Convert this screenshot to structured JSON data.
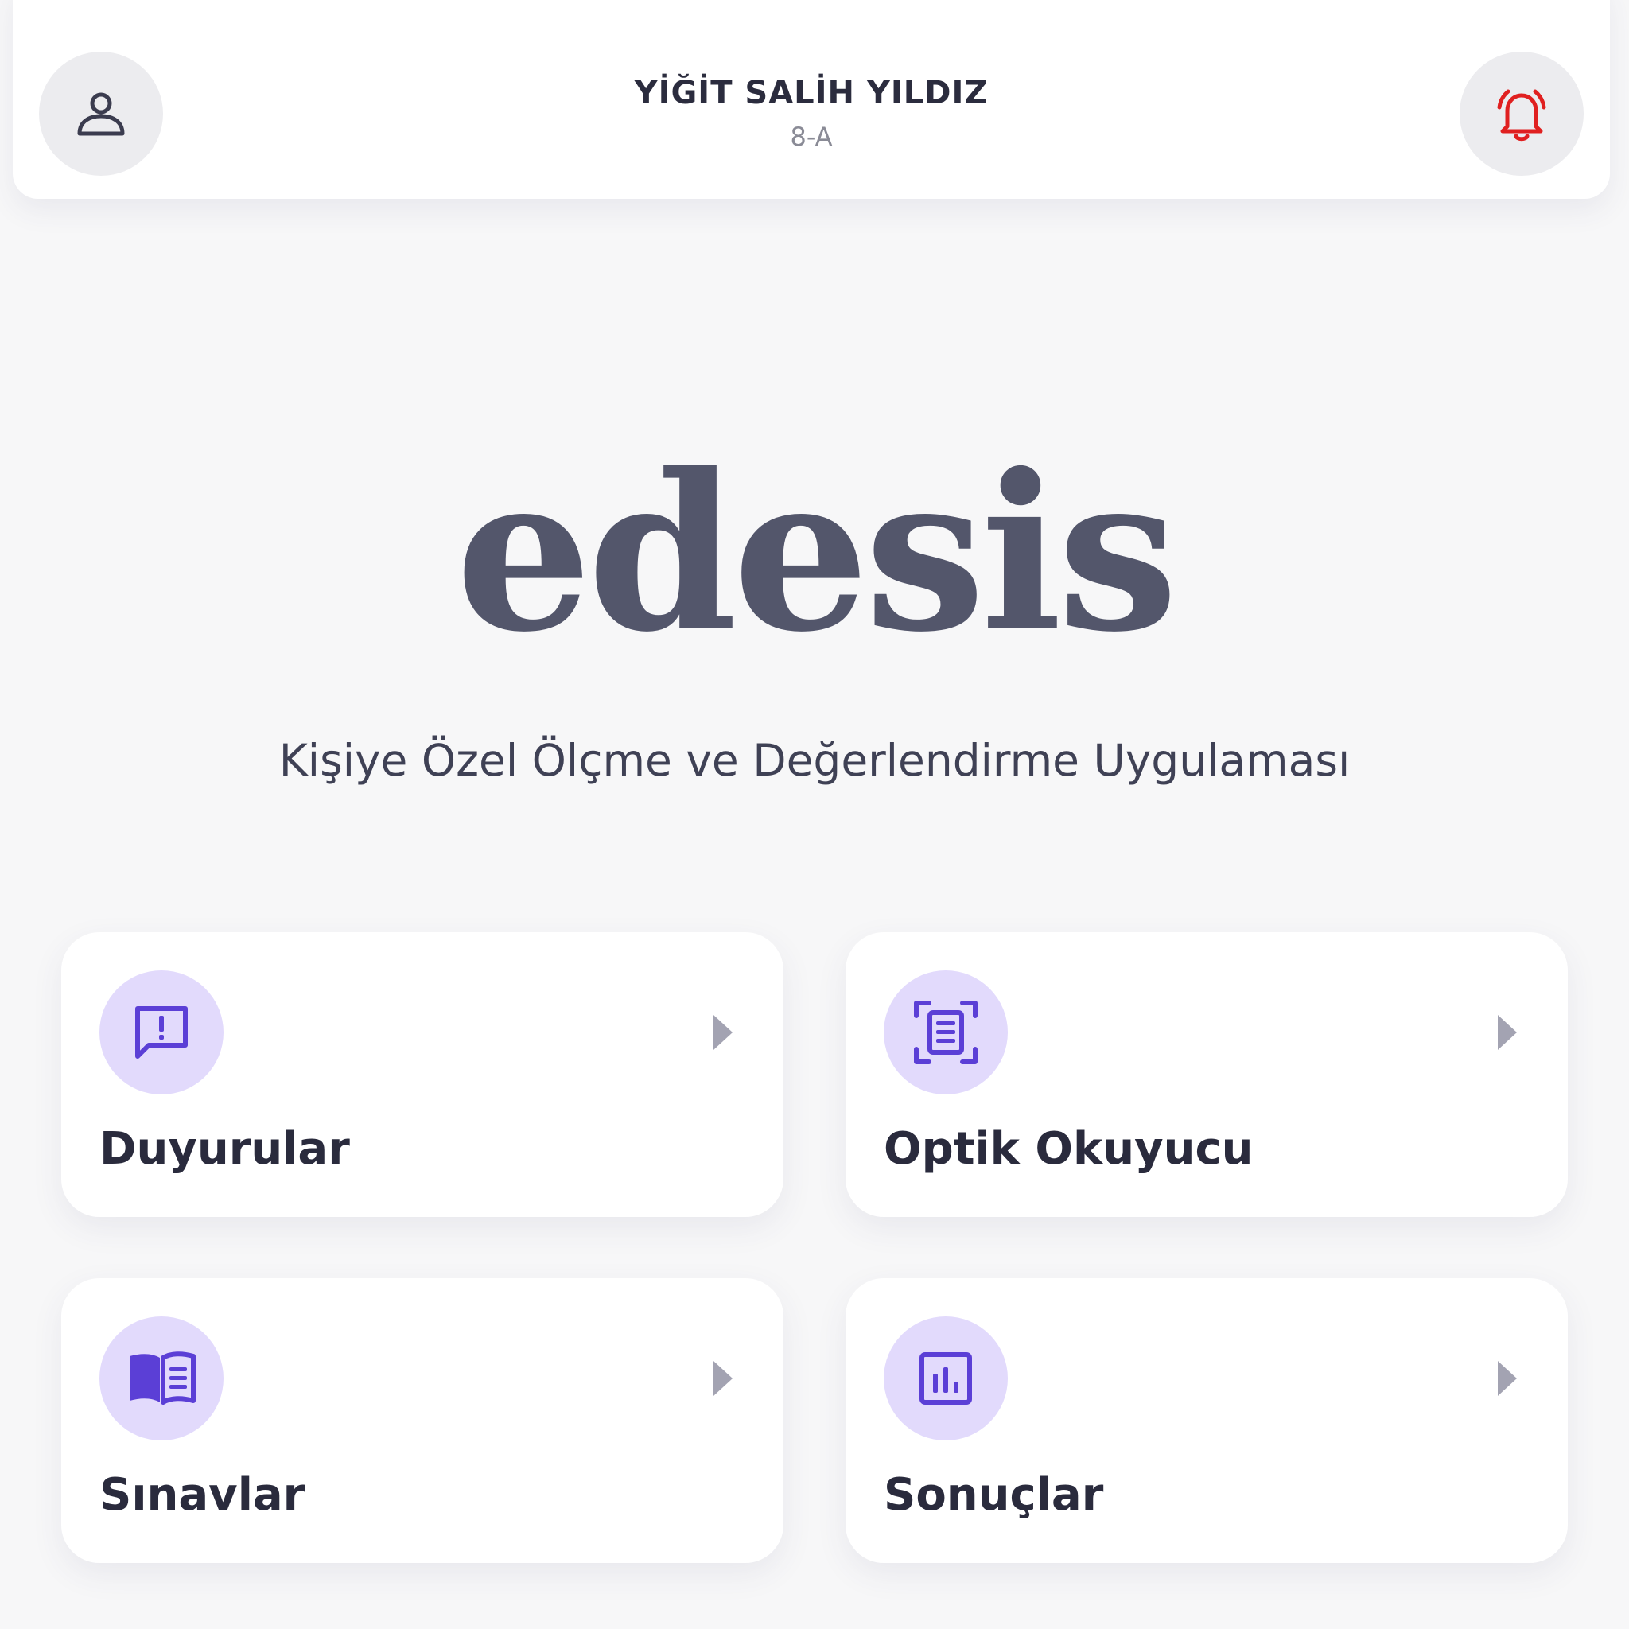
{
  "header": {
    "user_name": "YİĞİT SALİH YILDIZ",
    "user_class": "8-A",
    "avatar_icon": "user-icon",
    "notification_icon": "bell-icon",
    "notification_color": "#e02020"
  },
  "brand": {
    "logo_text": "edesis",
    "tagline": "Kişiye Özel Ölçme ve Değerlendirme Uygulaması",
    "logo_color": "#53566b"
  },
  "menu": {
    "accent_color": "#5b3fd6",
    "icon_bg_color": "#e2dafc",
    "cards": [
      {
        "label": "Duyurular",
        "icon": "announcement-icon"
      },
      {
        "label": "Optik Okuyucu",
        "icon": "document-scan-icon"
      },
      {
        "label": "Sınavlar",
        "icon": "open-book-icon"
      },
      {
        "label": "Sonuçlar",
        "icon": "bar-chart-icon"
      }
    ]
  }
}
